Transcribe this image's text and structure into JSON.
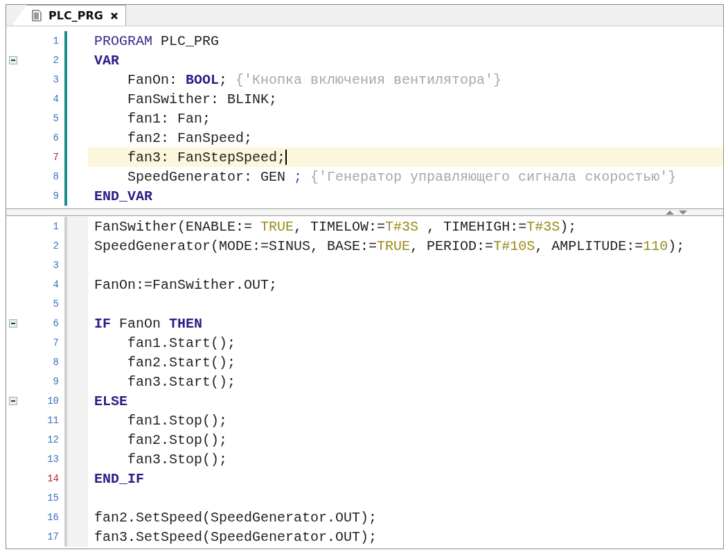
{
  "tab": {
    "title": "PLC_PRG",
    "selected": true
  },
  "declaration": [
    {
      "number": "1",
      "marked": false,
      "current": false,
      "indented": false,
      "tokens": [
        {
          "kind": "kw",
          "text": "PROGRAM"
        },
        {
          "kind": "plain",
          "text": " PLC_PRG"
        }
      ]
    },
    {
      "number": "2",
      "marked": false,
      "expanded": true,
      "current": false,
      "indented": false,
      "tokens": [
        {
          "kind": "kwb",
          "text": "VAR"
        }
      ]
    },
    {
      "number": "3",
      "marked": false,
      "current": false,
      "indented": true,
      "tokens": [
        {
          "kind": "plain",
          "text": "FanOn: "
        },
        {
          "kind": "kwb",
          "text": "BOOL"
        },
        {
          "kind": "plain",
          "text": "; "
        },
        {
          "kind": "cmt",
          "text": "{'Кнопка включения вентилятора'}"
        }
      ]
    },
    {
      "number": "4",
      "marked": false,
      "current": false,
      "indented": true,
      "tokens": [
        {
          "kind": "plain",
          "text": "FanSwither: BLINK;"
        }
      ]
    },
    {
      "number": "5",
      "marked": false,
      "current": false,
      "indented": true,
      "tokens": [
        {
          "kind": "plain",
          "text": "fan1: Fan;"
        }
      ]
    },
    {
      "number": "6",
      "marked": false,
      "current": false,
      "indented": true,
      "tokens": [
        {
          "kind": "plain",
          "text": "fan2: FanSpeed;"
        }
      ]
    },
    {
      "number": "7",
      "marked": true,
      "current": true,
      "indented": true,
      "tokens": [
        {
          "kind": "plain",
          "text": "fan3: FanStepSpeed;"
        }
      ]
    },
    {
      "number": "8",
      "marked": false,
      "current": false,
      "indented": true,
      "tokens": [
        {
          "kind": "plain",
          "text": "SpeedGenerator: GEN "
        },
        {
          "kind": "punct",
          "text": "; "
        },
        {
          "kind": "cmt",
          "text": "{'Генератор управляющего сигнала скоростью'}"
        }
      ]
    },
    {
      "number": "9",
      "marked": false,
      "current": false,
      "indented": false,
      "tokens": [
        {
          "kind": "kwb",
          "text": "END_VAR"
        }
      ]
    }
  ],
  "implementation": [
    {
      "number": "1",
      "marked": false,
      "current": false,
      "indented": false,
      "tokens": [
        {
          "kind": "plain",
          "text": "FanSwither(ENABLE:= "
        },
        {
          "kind": "lit",
          "text": "TRUE"
        },
        {
          "kind": "plain",
          "text": ", TIMELOW:="
        },
        {
          "kind": "lit",
          "text": "T#3S"
        },
        {
          "kind": "plain",
          "text": " , TIMEHIGH:="
        },
        {
          "kind": "lit",
          "text": "T#3S"
        },
        {
          "kind": "plain",
          "text": ");"
        }
      ]
    },
    {
      "number": "2",
      "marked": false,
      "current": false,
      "indented": false,
      "tokens": [
        {
          "kind": "plain",
          "text": "SpeedGenerator(MODE:=SINUS, BASE:="
        },
        {
          "kind": "lit",
          "text": "TRUE"
        },
        {
          "kind": "plain",
          "text": ", PERIOD:="
        },
        {
          "kind": "lit",
          "text": "T#10S"
        },
        {
          "kind": "plain",
          "text": ", AMPLITUDE:="
        },
        {
          "kind": "lit",
          "text": "110"
        },
        {
          "kind": "plain",
          "text": ");"
        }
      ]
    },
    {
      "number": "3",
      "marked": false,
      "current": false
    },
    {
      "number": "4",
      "marked": false,
      "current": false,
      "indented": false,
      "tokens": [
        {
          "kind": "plain",
          "text": "FanOn:=FanSwither.OUT;"
        }
      ]
    },
    {
      "number": "5",
      "marked": false,
      "current": false
    },
    {
      "number": "6",
      "marked": false,
      "expanded": true,
      "current": false,
      "indented": false,
      "tokens": [
        {
          "kind": "kwb",
          "text": "IF"
        },
        {
          "kind": "plain",
          "text": " FanOn "
        },
        {
          "kind": "kwb",
          "text": "THEN"
        }
      ]
    },
    {
      "number": "7",
      "marked": false,
      "current": false,
      "indented": true,
      "tokens": [
        {
          "kind": "plain",
          "text": "fan1.Start();"
        }
      ]
    },
    {
      "number": "8",
      "marked": false,
      "current": false,
      "indented": true,
      "tokens": [
        {
          "kind": "plain",
          "text": "fan2.Start();"
        }
      ]
    },
    {
      "number": "9",
      "marked": false,
      "current": false,
      "indented": true,
      "tokens": [
        {
          "kind": "plain",
          "text": "fan3.Start();"
        }
      ]
    },
    {
      "number": "10",
      "marked": false,
      "expanded": true,
      "current": false,
      "indented": false,
      "tokens": [
        {
          "kind": "kwb",
          "text": "ELSE"
        }
      ]
    },
    {
      "number": "11",
      "marked": false,
      "current": false,
      "indented": true,
      "tokens": [
        {
          "kind": "plain",
          "text": "fan1.Stop();"
        }
      ]
    },
    {
      "number": "12",
      "marked": false,
      "current": false,
      "indented": true,
      "tokens": [
        {
          "kind": "plain",
          "text": "fan2.Stop();"
        }
      ]
    },
    {
      "number": "13",
      "marked": false,
      "current": false,
      "indented": true,
      "tokens": [
        {
          "kind": "plain",
          "text": "fan3.Stop();"
        }
      ]
    },
    {
      "number": "14",
      "marked": true,
      "current": false,
      "indented": false,
      "tokens": [
        {
          "kind": "kwb",
          "text": "END_IF"
        }
      ]
    },
    {
      "number": "15",
      "marked": false,
      "current": false
    },
    {
      "number": "16",
      "marked": false,
      "current": false,
      "indented": false,
      "tokens": [
        {
          "kind": "plain",
          "text": "fan2.SetSpeed(SpeedGenerator.OUT);"
        }
      ]
    },
    {
      "number": "17",
      "marked": false,
      "current": false,
      "indented": false,
      "tokens": [
        {
          "kind": "plain",
          "text": "fan3.SetSpeed(SpeedGenerator.OUT);"
        }
      ]
    }
  ]
}
